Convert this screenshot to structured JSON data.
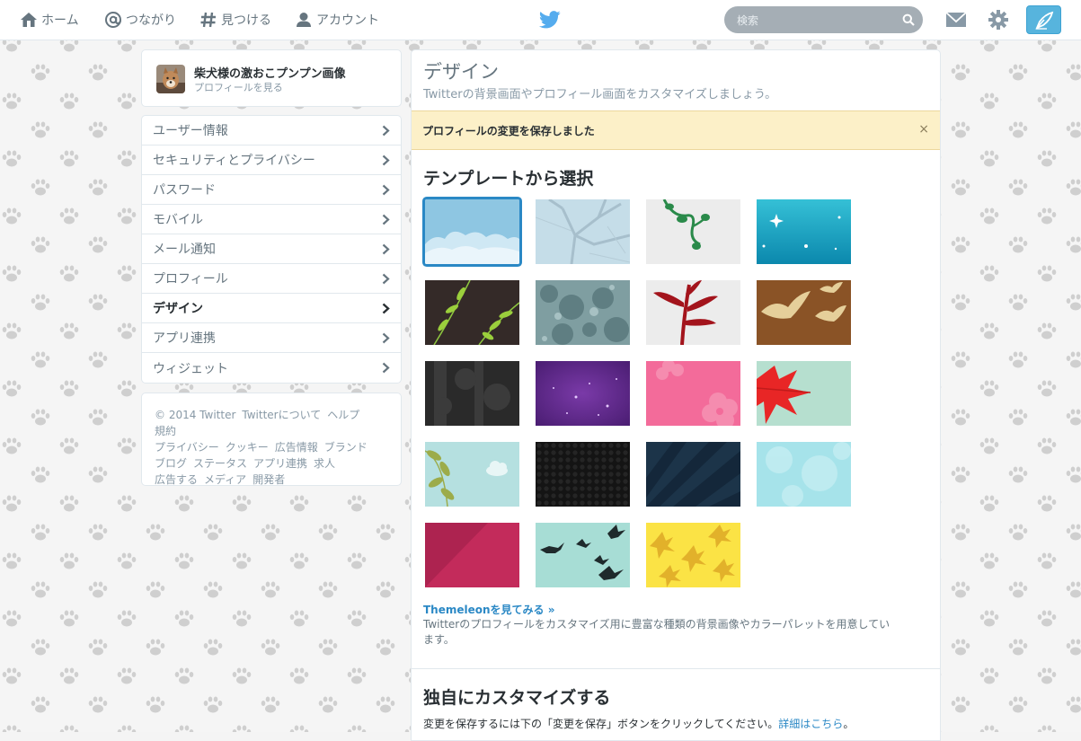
{
  "nav": {
    "home": "ホーム",
    "connect": "つながり",
    "discover": "見つける",
    "account": "アカウント"
  },
  "search": {
    "placeholder": "検索"
  },
  "profile": {
    "name": "柴犬様の激おこプンプン画像",
    "view_profile": "プロフィールを見る"
  },
  "settings_menu": [
    {
      "label": "ユーザー情報"
    },
    {
      "label": "セキュリティとプライバシー"
    },
    {
      "label": "パスワード"
    },
    {
      "label": "モバイル"
    },
    {
      "label": "メール通知"
    },
    {
      "label": "プロフィール"
    },
    {
      "label": "デザイン",
      "active": true
    },
    {
      "label": "アプリ連携"
    },
    {
      "label": "ウィジェット"
    }
  ],
  "footer": {
    "links": [
      "© 2014 Twitter",
      "Twitterについて",
      "ヘルプ",
      "規約",
      "プライバシー",
      "クッキー",
      "広告情報",
      "ブランド",
      "ブログ",
      "ステータス",
      "アプリ連携",
      "求人",
      "広告する",
      "メディア",
      "開発者"
    ]
  },
  "design": {
    "title": "デザイン",
    "subtitle": "Twitterの背景画面やプロフィール画面をカスタマイズしましょう。",
    "alert": "プロフィールの変更を保存しました",
    "alert_close": "×",
    "template_title": "テンプレートから選択",
    "selected_theme": 0,
    "themeleon_link": "Themeleonを見てみる »",
    "themeleon_desc": "Twitterのプロフィールをカスタマイズ用に豊富な種類の背景画像やカラーパレットを用意しています。",
    "custom_title": "独自にカスタマイズする",
    "custom_desc_prefix": "変更を保存するには下の「変更を保存」ボタンをクリックしてください。",
    "custom_desc_link": "詳細はこちら",
    "custom_desc_suffix": "。"
  },
  "colors": {
    "accent": "#2a88c5",
    "tweet_button": "#57b4dd",
    "alert_bg": "#fcf0c8",
    "theme_colors": [
      "#8ec6e2",
      "#c5dde8",
      "#ececec",
      "#1a9ab8",
      "#342a28",
      "#7f9ea1",
      "#ececec",
      "#8a5326",
      "#2a2a2a",
      "#5b2a8a",
      "#f36b9a",
      "#b6dfcf",
      "#b5e0e0",
      "#141414",
      "#14273a",
      "#a6e3ea",
      "#c32b5b",
      "#a7ddd5",
      "#fbe345"
    ]
  }
}
